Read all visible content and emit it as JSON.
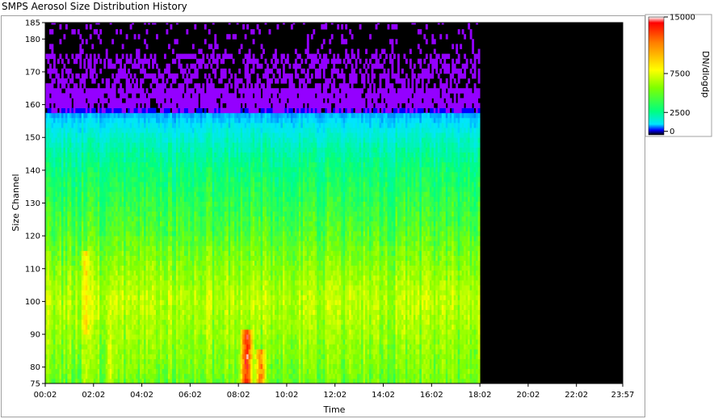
{
  "window": {
    "title": "SMPS Aerosol Size Distribution History"
  },
  "colors": {
    "background": "#000000",
    "scale": [
      "#0000ff",
      "#00e5ff",
      "#00ff7f",
      "#7fff00",
      "#ffff00",
      "#ff8000",
      "#ff0000",
      "#ffffff"
    ],
    "sparse_high": "#9400ff"
  },
  "chart_data": {
    "type": "heatmap",
    "title": "",
    "xlabel": "Time",
    "ylabel": "Size Channel",
    "x_ticks": [
      "00:02",
      "02:02",
      "04:02",
      "06:02",
      "08:02",
      "10:02",
      "12:02",
      "14:02",
      "16:02",
      "18:02",
      "20:02",
      "22:02",
      "23:57"
    ],
    "y_ticks": [
      "75",
      "80",
      "90",
      "100",
      "110",
      "120",
      "130",
      "140",
      "150",
      "160",
      "170",
      "180",
      "185"
    ],
    "xlim": [
      "00:02",
      "23:57"
    ],
    "ylim": [
      75,
      185
    ],
    "data_end_time": "18:02",
    "colorbar": {
      "label": "DN/dlogdp",
      "ticks": [
        "0",
        "2500",
        "7500",
        "15000"
      ],
      "range": [
        0,
        15000
      ]
    },
    "profile": {
      "description_channels": [
        75,
        150,
        160,
        185
      ],
      "typical_values_by_channel": [
        {
          "channel": 75,
          "value": 3200
        },
        {
          "channel": 100,
          "value": 4500
        },
        {
          "channel": 120,
          "value": 2800
        },
        {
          "channel": 140,
          "value": 1800
        },
        {
          "channel": 150,
          "value": 1100
        },
        {
          "channel": 156,
          "value": 600
        },
        {
          "channel": 165,
          "value": 120
        },
        {
          "channel": 185,
          "value": 40
        }
      ],
      "events": [
        {
          "time": "01:40",
          "channel_range": [
            90,
            115
          ],
          "peak": 7500
        },
        {
          "time": "02:40",
          "channel_range": [
            75,
            100
          ],
          "peak": 6000
        },
        {
          "time": "08:20",
          "channel_range": [
            75,
            90
          ],
          "peak": 15000
        },
        {
          "time": "08:55",
          "channel_range": [
            75,
            85
          ],
          "peak": 11000
        }
      ]
    }
  }
}
